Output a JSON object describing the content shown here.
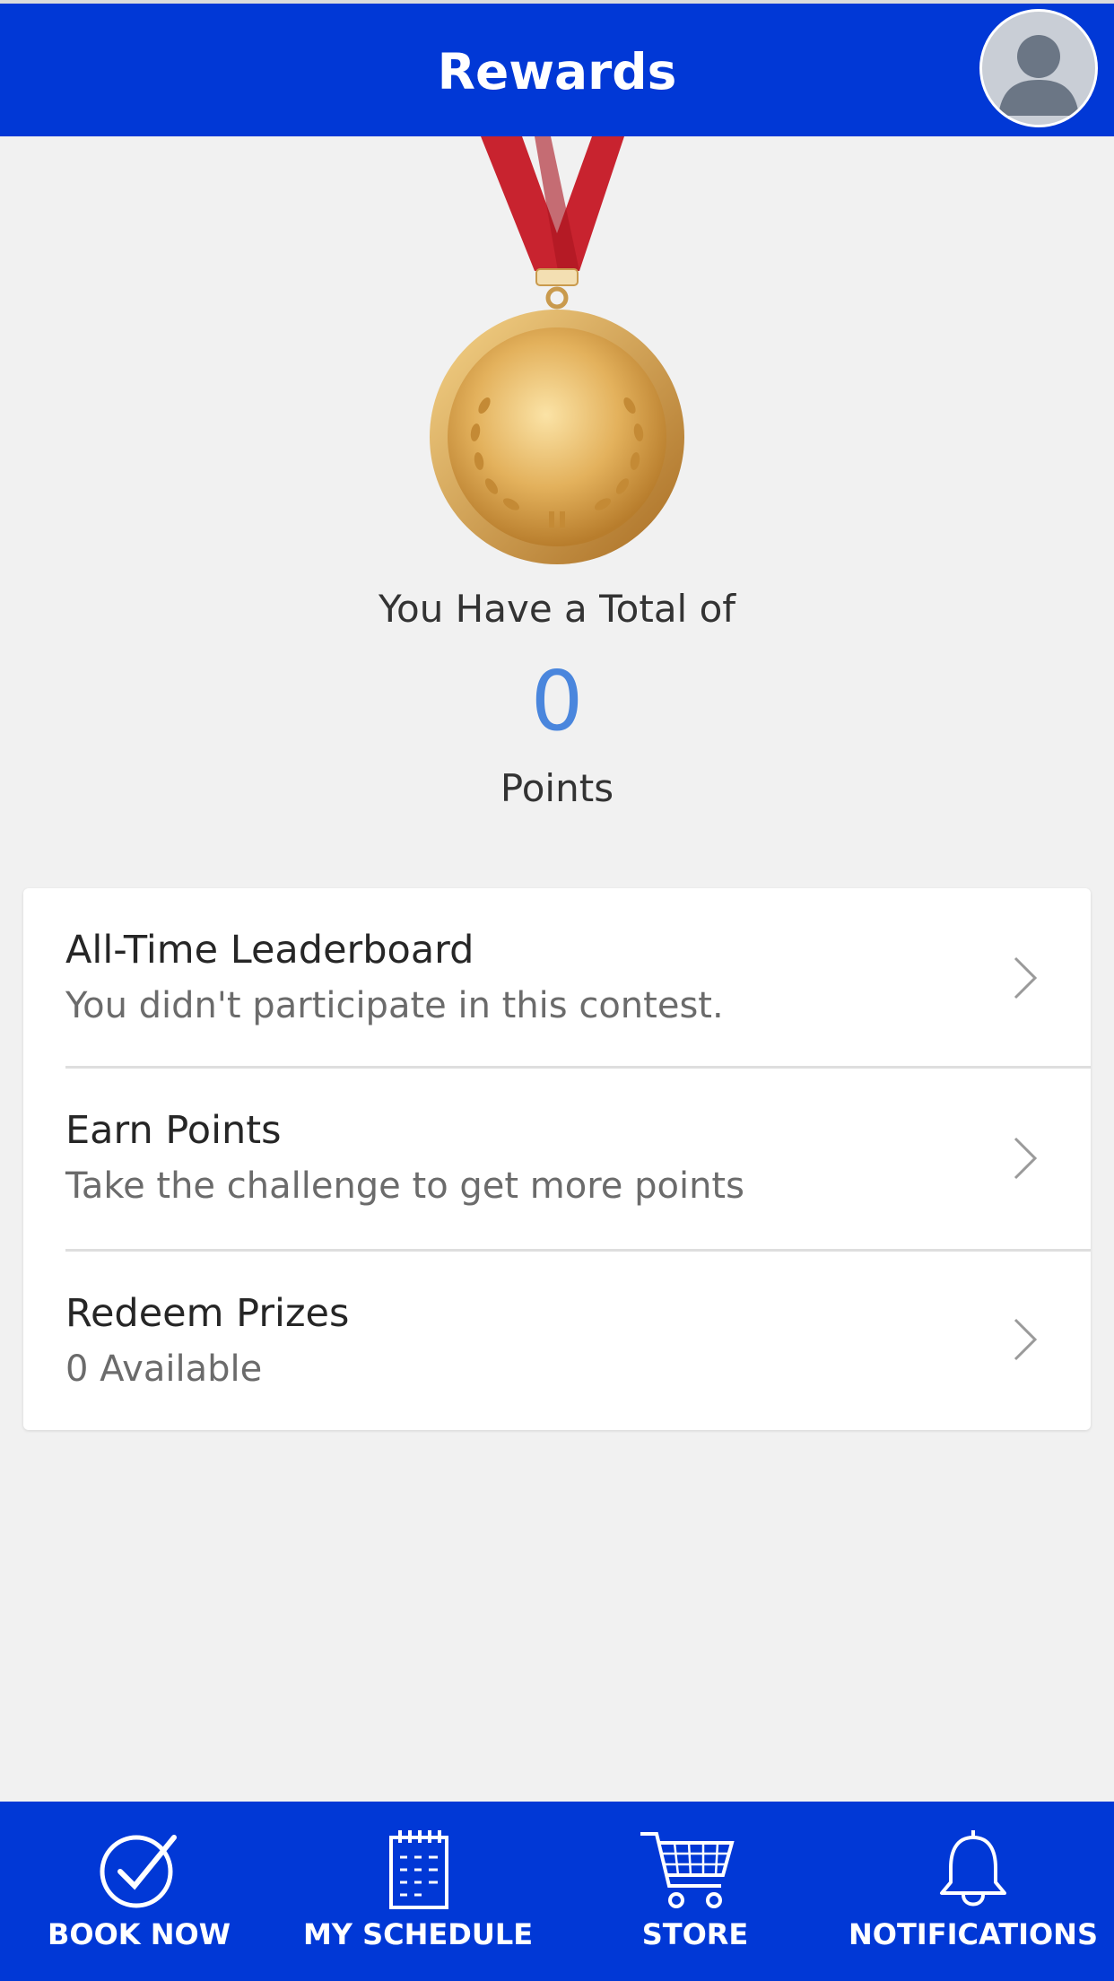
{
  "header": {
    "title": "Rewards",
    "avatar_icon": "user-avatar-icon",
    "background": "#0138d6"
  },
  "summary": {
    "total_label": "You Have a Total of",
    "points_value": "0",
    "points_label": "Points",
    "medal_icon": "gold-medal-icon",
    "points_color": "#4a86dd"
  },
  "menu": {
    "items": [
      {
        "title": "All-Time Leaderboard",
        "subtitle": "You didn't participate in this contest."
      },
      {
        "title": "Earn Points",
        "subtitle": "Take the challenge to get more points"
      },
      {
        "title": "Redeem Prizes",
        "subtitle": "0 Available"
      }
    ]
  },
  "tabbar": {
    "items": [
      {
        "label": "BOOK NOW",
        "icon": "check-circle-icon"
      },
      {
        "label": "MY SCHEDULE",
        "icon": "calendar-icon"
      },
      {
        "label": "STORE",
        "icon": "cart-icon"
      },
      {
        "label": "NOTIFICATIONS",
        "icon": "bell-icon"
      }
    ]
  }
}
